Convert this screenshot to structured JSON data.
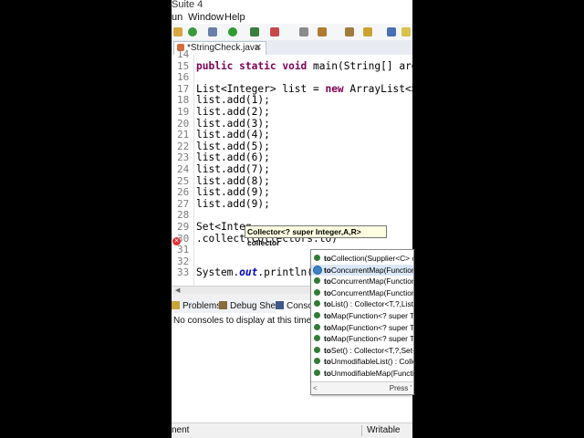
{
  "window": {
    "title": "Suite 4"
  },
  "menu": [
    "un",
    "Window",
    "Help"
  ],
  "editor_tab": {
    "label": "*StringCheck.java",
    "close": "✕"
  },
  "code_lines": [
    {
      "num": "14",
      "text": ""
    },
    {
      "num": "15",
      "text": "public static void main(String[] args) {"
    },
    {
      "num": "16",
      "text": ""
    },
    {
      "num": "17",
      "text": "List<Integer> list = new ArrayList<>();"
    },
    {
      "num": "18",
      "text": "list.add(1);"
    },
    {
      "num": "19",
      "text": "list.add(2);"
    },
    {
      "num": "20",
      "text": "list.add(3);"
    },
    {
      "num": "21",
      "text": "list.add(4);"
    },
    {
      "num": "22",
      "text": "list.add(5);"
    },
    {
      "num": "23",
      "text": "list.add(6);"
    },
    {
      "num": "24",
      "text": "list.add(7);"
    },
    {
      "num": "25",
      "text": "list.add(8);"
    },
    {
      "num": "26",
      "text": "list.add(9);"
    },
    {
      "num": "27",
      "text": "list.add(9);"
    },
    {
      "num": "28",
      "text": ""
    },
    {
      "num": "29",
      "text": "Set<Integ"
    },
    {
      "num": "30",
      "text": ".collect(Collectors.to)"
    },
    {
      "num": "31",
      "text": ""
    },
    {
      "num": "32",
      "text": ""
    },
    {
      "num": "33",
      "text": "System.out.println(s"
    }
  ],
  "tooltip": "Collector<? super Integer,A,R> collector",
  "view_tabs": [
    "Problems",
    "Debug Shell",
    "Console"
  ],
  "console_message": "No consoles to display at this time.",
  "status": {
    "left": "nent",
    "right": "Writable"
  },
  "completion": {
    "items": [
      {
        "bold": "to",
        "rest": "Collection(Supplier<C> c"
      },
      {
        "bold": "to",
        "rest": "ConcurrentMap(Function"
      },
      {
        "bold": "to",
        "rest": "ConcurrentMap(Function"
      },
      {
        "bold": "to",
        "rest": "ConcurrentMap(Function"
      },
      {
        "bold": "to",
        "rest": "List() : Collector<T,?,List<"
      },
      {
        "bold": "to",
        "rest": "Map(Function<? super T,?"
      },
      {
        "bold": "to",
        "rest": "Map(Function<? super T,?"
      },
      {
        "bold": "to",
        "rest": "Map(Function<? super T,?"
      },
      {
        "bold": "to",
        "rest": "Set() : Collector<T,?,Set<T"
      },
      {
        "bold": "to",
        "rest": "UnmodifiableList() : Colle"
      },
      {
        "bold": "to",
        "rest": "UnmodifiableMap(Functio"
      }
    ],
    "footer_left": "<",
    "footer_right": "Press '"
  },
  "colors": {
    "keyword": "#7f0055",
    "static_field": "#0000c0",
    "selection": "#dbe8f9",
    "tooltip_bg": "#ffffe1"
  }
}
